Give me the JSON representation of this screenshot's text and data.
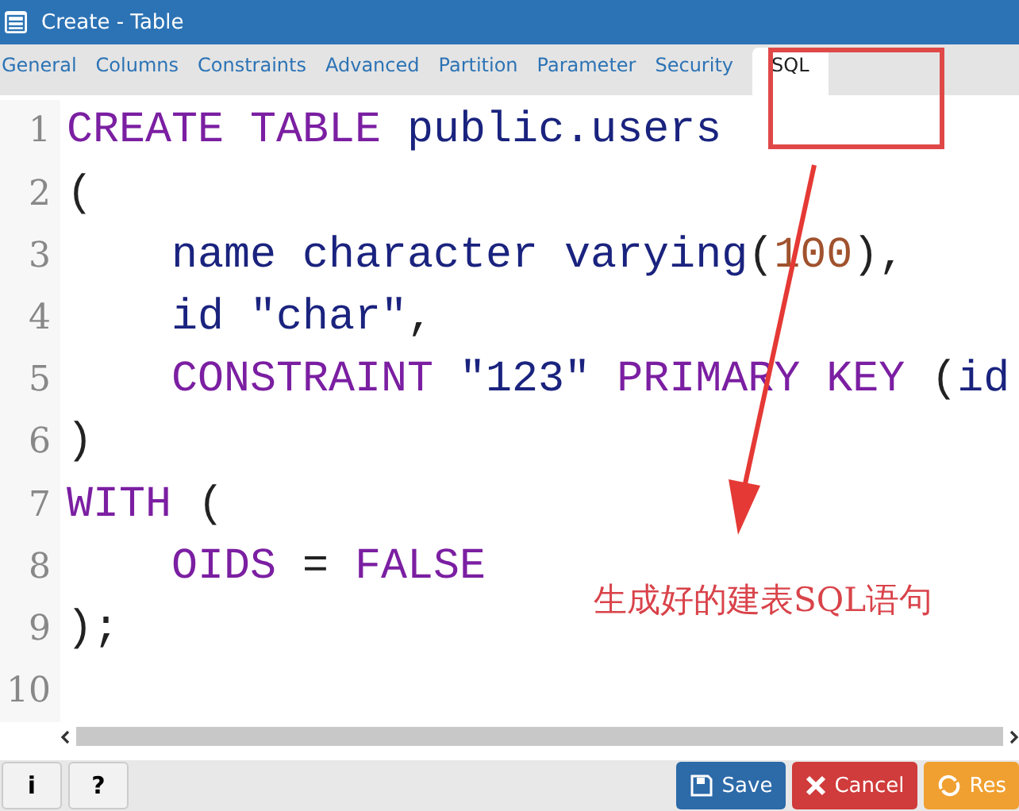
{
  "window": {
    "title": "Create - Table"
  },
  "tabs": [
    {
      "label": "General",
      "selected": false
    },
    {
      "label": "Columns",
      "selected": false
    },
    {
      "label": "Constraints",
      "selected": false
    },
    {
      "label": "Advanced",
      "selected": false
    },
    {
      "label": "Partition",
      "selected": false
    },
    {
      "label": "Parameter",
      "selected": false
    },
    {
      "label": "Security",
      "selected": false
    },
    {
      "label": "SQL",
      "selected": true
    }
  ],
  "editor": {
    "lines": [
      {
        "number": "1",
        "tokens": [
          {
            "kind": "kw",
            "text": "CREATE TABLE"
          },
          {
            "kind": "name",
            "text": " public.users"
          }
        ]
      },
      {
        "number": "2",
        "tokens": [
          {
            "kind": "plain",
            "text": "("
          }
        ]
      },
      {
        "number": "3",
        "tokens": [
          {
            "kind": "name",
            "text": "    name character varying"
          },
          {
            "kind": "plain",
            "text": "("
          },
          {
            "kind": "num",
            "text": "100"
          },
          {
            "kind": "plain",
            "text": "),"
          }
        ]
      },
      {
        "number": "4",
        "tokens": [
          {
            "kind": "name",
            "text": "    id \"char\""
          },
          {
            "kind": "plain",
            "text": ","
          }
        ]
      },
      {
        "number": "5",
        "tokens": [
          {
            "kind": "kw",
            "text": "    CONSTRAINT"
          },
          {
            "kind": "name",
            "text": " \"123\""
          },
          {
            "kind": "kw",
            "text": " PRIMARY KEY"
          },
          {
            "kind": "plain",
            "text": " ("
          },
          {
            "kind": "name",
            "text": "id"
          }
        ]
      },
      {
        "number": "6",
        "tokens": [
          {
            "kind": "plain",
            "text": ")"
          }
        ]
      },
      {
        "number": "7",
        "tokens": [
          {
            "kind": "kw",
            "text": "WITH"
          },
          {
            "kind": "plain",
            "text": " ("
          }
        ]
      },
      {
        "number": "8",
        "tokens": [
          {
            "kind": "kw",
            "text": "    OIDS"
          },
          {
            "kind": "plain",
            "text": " = "
          },
          {
            "kind": "kw",
            "text": "FALSE"
          }
        ]
      },
      {
        "number": "9",
        "tokens": [
          {
            "kind": "plain",
            "text": ");"
          }
        ]
      },
      {
        "number": "10"
      }
    ]
  },
  "annotation": {
    "text": "生成好的建表SQL语句"
  },
  "footer": {
    "left_buttons": [
      {
        "label": "i"
      },
      {
        "label": "?"
      }
    ],
    "right_buttons": [
      {
        "label": "Save",
        "kind": "save"
      },
      {
        "label": "Cancel",
        "kind": "cancel"
      },
      {
        "label": "Res",
        "kind": "reset"
      }
    ]
  }
}
